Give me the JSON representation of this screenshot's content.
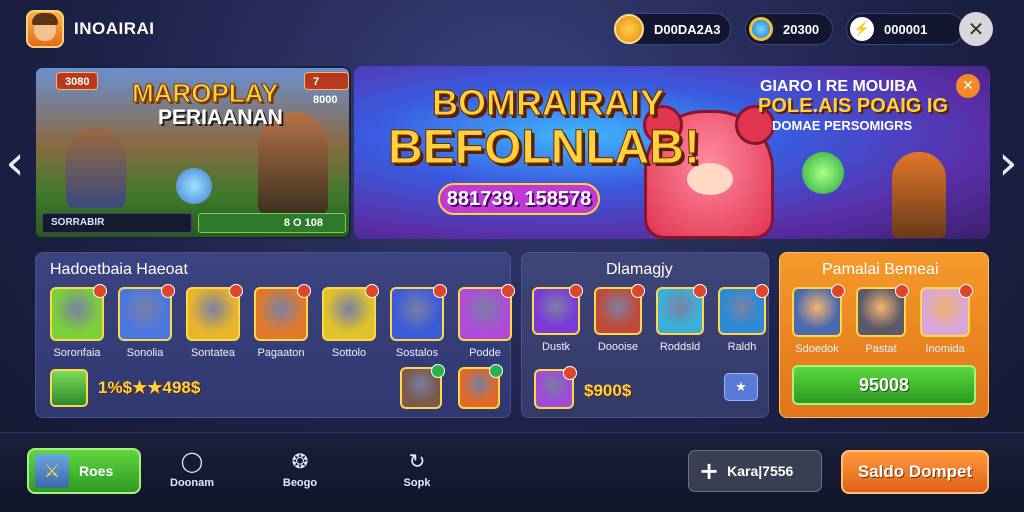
{
  "header": {
    "brand": "INOAIRAI",
    "currency1": "D00DA2A3",
    "currency2": "20300",
    "currency3": "000001 ",
    "close_symbol": "✕"
  },
  "banner_left": {
    "title_line1": "MAROPLAY",
    "title_line2": "PERIAANAN",
    "tag_left": "3080",
    "tag_right": "7 8000",
    "input_text": "SORRABIR",
    "button_text": "8 O 108"
  },
  "banner_right": {
    "title_line1": "BOMRAIRAIY",
    "title_line2": "BEFOLNLAB!",
    "amount": "881739. 158578",
    "side_line1": "GIARO I RE MOUIBA",
    "side_line2": "POLE.AIS POAIG IG",
    "side_line3": "DOMAE PERSOMIGRS",
    "close_symbol": "✕"
  },
  "nav_arrows": {
    "left": "‹",
    "right": "›"
  },
  "panel1": {
    "title": "Hadoetbaia Haeoat",
    "items": [
      {
        "label": "Soronfaia",
        "color": "#7bcf3a"
      },
      {
        "label": "Sonolia",
        "color": "#4a78e0"
      },
      {
        "label": "Sontatea",
        "color": "#e8b52a"
      },
      {
        "label": "Pagaaton",
        "color": "#e07a2a"
      },
      {
        "label": "Sottolo",
        "color": "#e0c22a"
      },
      {
        "label": "Sostalos",
        "color": "#3a5ad8"
      },
      {
        "label": "Podde",
        "color": "#b04ad8"
      }
    ],
    "coins_text": "1%$★★498$",
    "extra_tiles": [
      {
        "color": "#7a5a4a"
      },
      {
        "color": "#e06a2a"
      }
    ]
  },
  "panel2": {
    "title": "Dlamagjy",
    "items": [
      {
        "label": "Dustk",
        "color": "#7a3ad8"
      },
      {
        "label": "Doooise",
        "color": "#c04a3a"
      },
      {
        "label": "Roddsld",
        "color": "#3ab0d8"
      },
      {
        "label": "Raldh",
        "color": "#2a8ad8"
      }
    ],
    "price": "$900$",
    "price_tile_color": "#a04ad8",
    "small_button_symbol": "★"
  },
  "panel3": {
    "title": "Pamalai Bemeai",
    "items": [
      {
        "label": "Sdoedok",
        "color": "#4a6ab0"
      },
      {
        "label": "Pastat",
        "color": "#5a5a6a"
      },
      {
        "label": "Inomida",
        "color": "#d8a6d8"
      }
    ],
    "buy_label": "95008"
  },
  "bottom_nav": {
    "home_label": "Roes",
    "items": [
      {
        "icon": "circle-icon",
        "glyph": "◯",
        "label": "Doonam"
      },
      {
        "icon": "shield-icon",
        "glyph": "❂",
        "label": "Beogo"
      },
      {
        "icon": "refresh-icon",
        "glyph": "↻",
        "label": "Sopk"
      }
    ],
    "add_label": "Kara|7556",
    "saldo_label": "Saldo Dompet"
  },
  "colors": {
    "accent": "#ffd23c",
    "primary_green": "#4fc233",
    "orange": "#f28a28"
  }
}
